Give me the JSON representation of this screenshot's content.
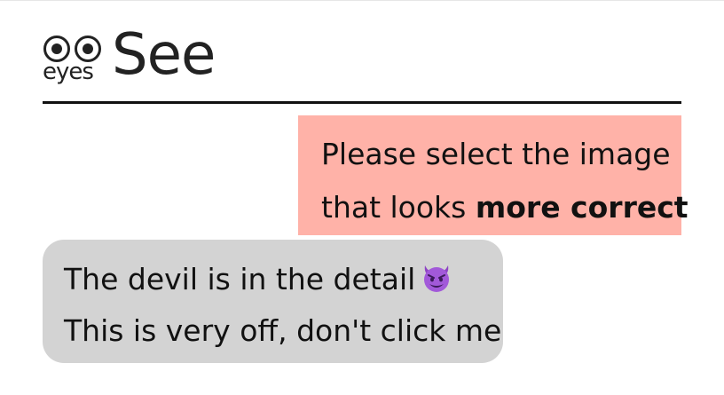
{
  "logo": {
    "small_text": "eyes",
    "big_text": "See"
  },
  "prompt": {
    "line1": "Please select the image",
    "line2_prefix": "that looks ",
    "line2_bold": "more correct"
  },
  "choice": {
    "line1": "The devil is in the detail",
    "line2": "This is very off, don't click me",
    "emoji_icon": "smiling-devil-icon"
  },
  "colors": {
    "prompt_bg": "#ffb2a8",
    "choice_bg": "#d3d3d3",
    "text": "#111111"
  }
}
